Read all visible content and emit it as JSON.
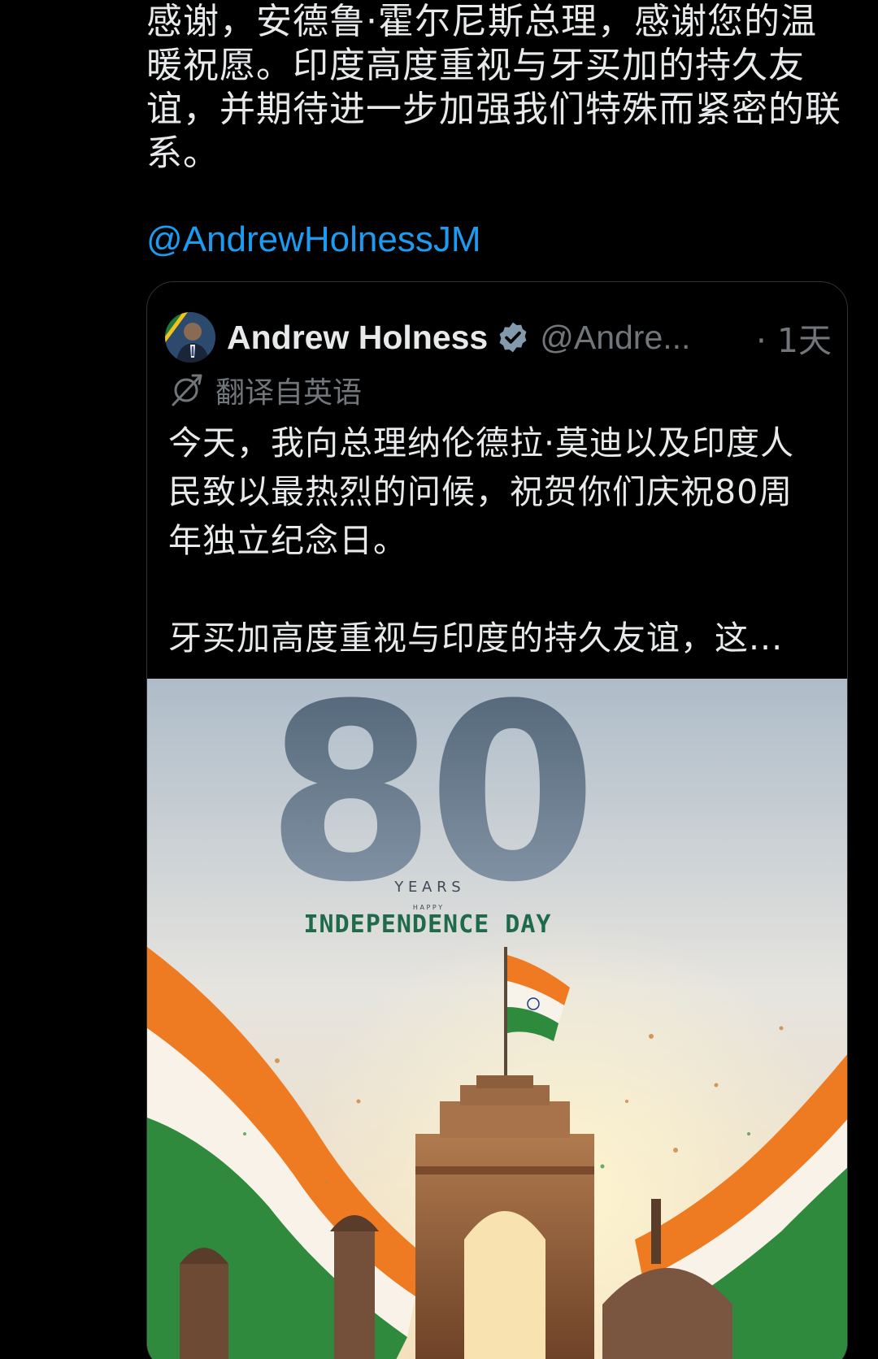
{
  "tweet": {
    "text": "感谢，安德鲁·霍尔尼斯总理，感谢您的温暖祝愿。印度高度重视与牙买加的持久友谊，并期待进一步加强我们特殊而紧密的联系。",
    "mention": "@AndrewHolnessJM"
  },
  "quote": {
    "author_name": "Andrew Holness",
    "handle": "@Andre...",
    "time": "· 1天",
    "translated_label": "翻译自英语",
    "paragraph1": "今天，我向总理纳伦德拉·莫迪以及印度人民致以最热烈的问候，祝贺你们庆祝80周年独立纪念日。",
    "paragraph2": "牙买加高度重视与印度的持久友谊，这..."
  },
  "poster": {
    "number": "80",
    "years": "Y E A R S",
    "happy": "H A P P Y",
    "title": "INDEPENDENCE DAY"
  },
  "icons": {
    "verified": "verified-badge-icon",
    "translate": "translate-icon"
  },
  "colors": {
    "background": "#000000",
    "text": "#e7e9ea",
    "muted": "#71767b",
    "link": "#1d9bf0",
    "border": "#2f3336"
  }
}
